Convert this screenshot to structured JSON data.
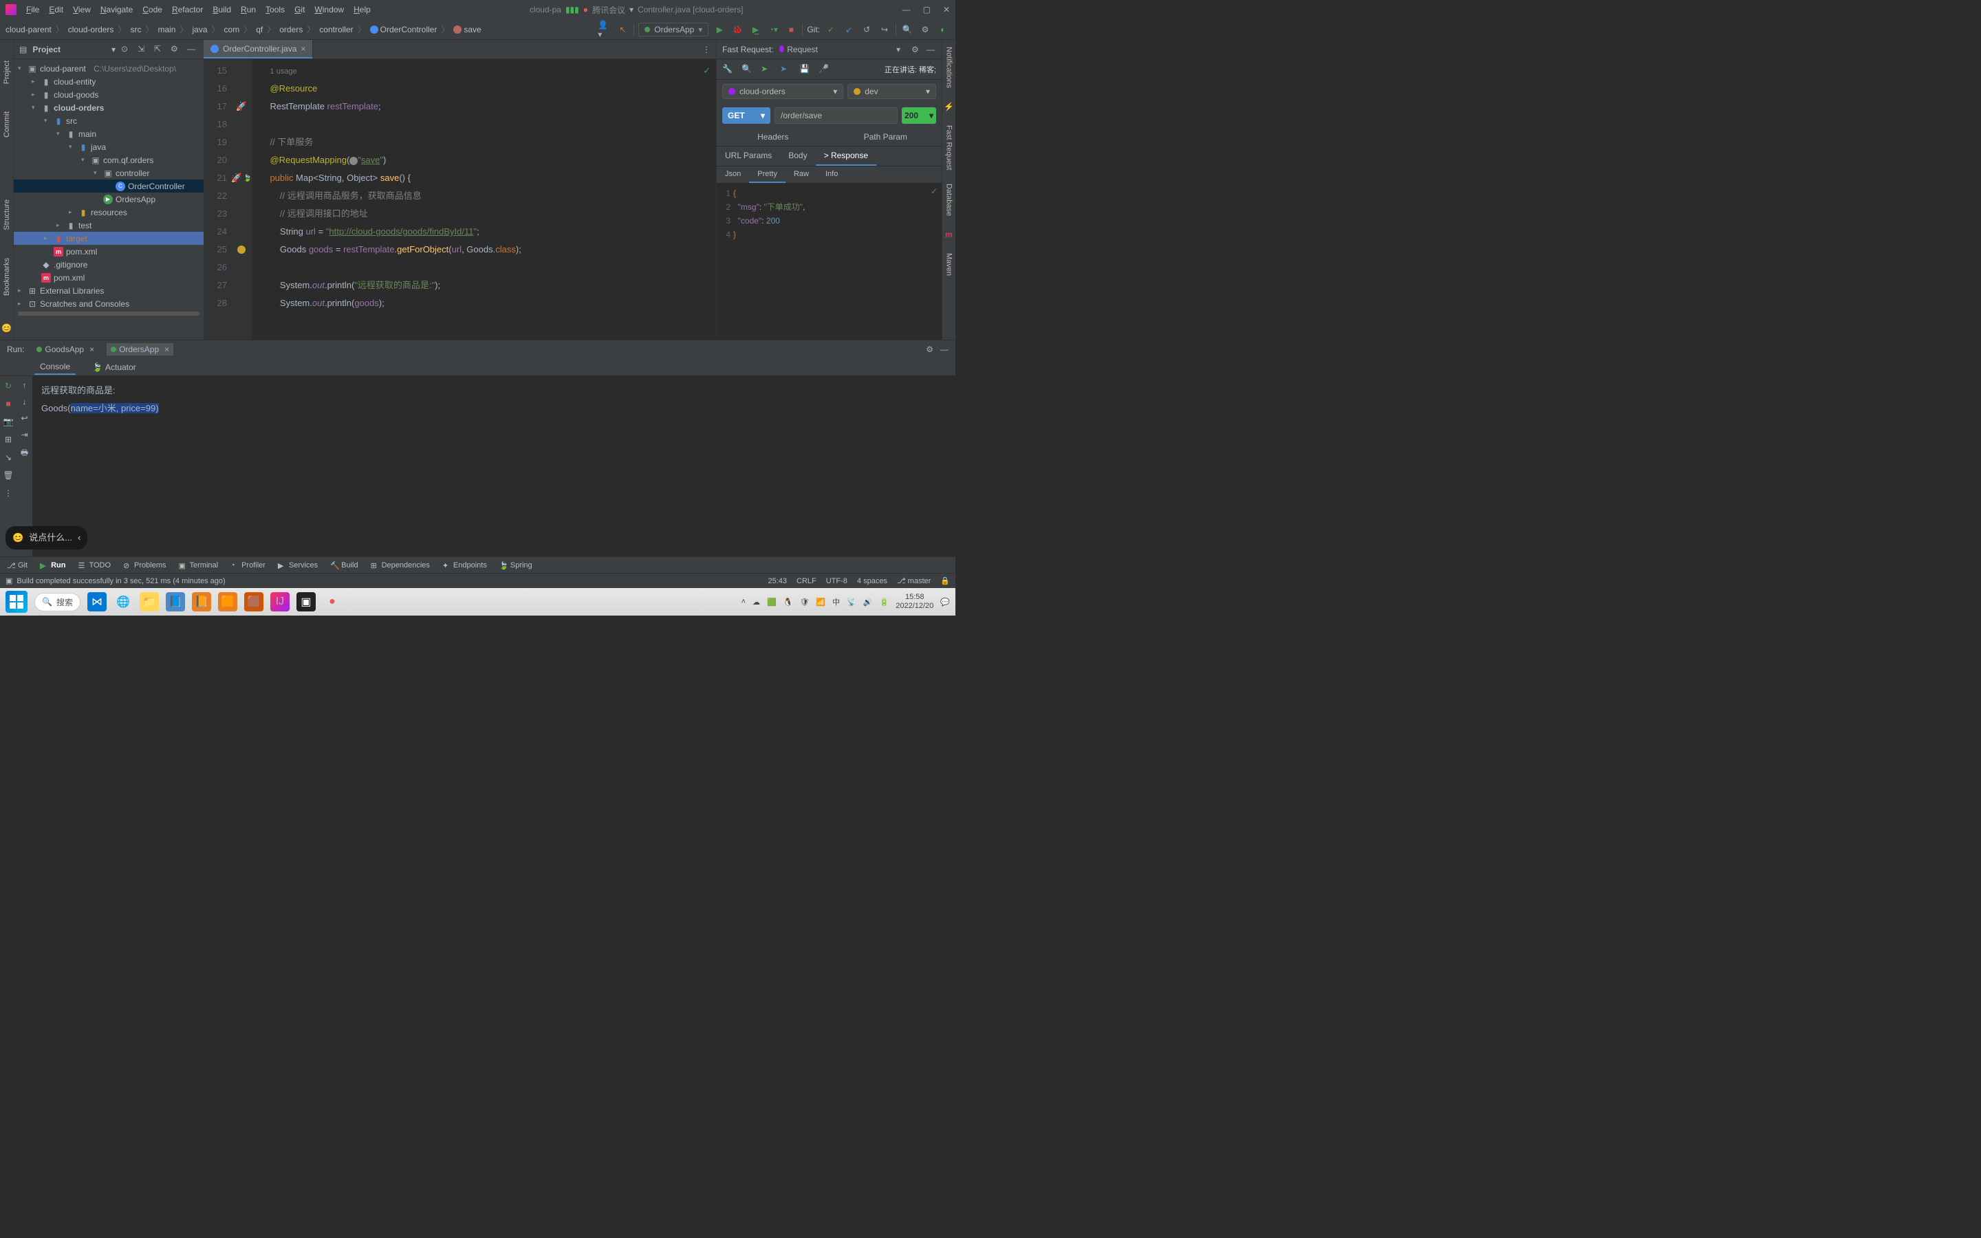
{
  "menubar": {
    "items": [
      "File",
      "Edit",
      "View",
      "Navigate",
      "Code",
      "Refactor",
      "Build",
      "Run",
      "Tools",
      "Git",
      "Window",
      "Help"
    ],
    "center_left": "cloud-pa",
    "meeting_app": "腾讯会议",
    "center_right": "Controller.java [cloud-orders]"
  },
  "breadcrumb": {
    "crumbs": [
      "cloud-parent",
      "cloud-orders",
      "src",
      "main",
      "java",
      "com",
      "qf",
      "orders",
      "controller"
    ],
    "class": "OrderController",
    "method": "save",
    "run_config": "OrdersApp",
    "git_label": "Git:"
  },
  "project": {
    "title": "Project",
    "root": "cloud-parent",
    "root_path": "C:\\Users\\zed\\Desktop\\",
    "nodes": {
      "cloud_entity": "cloud-entity",
      "cloud_goods": "cloud-goods",
      "cloud_orders": "cloud-orders",
      "src": "src",
      "main": "main",
      "java": "java",
      "pkg": "com.qf.orders",
      "controller": "controller",
      "order_controller": "OrderController",
      "orders_app": "OrdersApp",
      "resources": "resources",
      "test": "test",
      "target": "target",
      "pom1": "pom.xml",
      "gitignore": ".gitignore",
      "pom2": "pom.xml",
      "ext_libs": "External Libraries",
      "scratches": "Scratches and Consoles"
    }
  },
  "editor": {
    "tab": "OrderController.java",
    "lines": {
      "usage": "1 usage",
      "l16": "@Resource",
      "l17a": "RestTemplate ",
      "l17b": "restTemplate",
      "l17c": ";",
      "l19": "// 下单服务",
      "l20a": "@RequestMapping",
      "l20b": "(",
      "l20c": "\"",
      "l20d": "save",
      "l20e": "\"",
      "l20f": ")",
      "l21a": "public",
      "l21b": " Map<String, Object> ",
      "l21c": "save",
      "l21d": "() {",
      "l22": "// 远程调用商品服务，获取商品信息",
      "l23": "// 远程调用接口的地址",
      "l24a": "String ",
      "l24b": "url",
      "l24c": " = ",
      "l24d": "\"",
      "l24e": "http://cloud-goods/goods/findById/11",
      "l24f": "\"",
      "l24g": ";",
      "l25a": "Goods ",
      "l25b": "goods",
      "l25c": " = ",
      "l25d": "restTemplate",
      "l25e": ".",
      "l25f": "getForObject",
      "l25g": "(",
      "l25h": "url",
      "l25i": ", Goods.",
      "l25j": "class",
      "l25k": ");",
      "l27a": "System.",
      "l27b": "out",
      "l27c": ".println(",
      "l27d": "\"远程获取的商品是:\"",
      "l27e": ");",
      "l28a": "System.",
      "l28b": "out",
      "l28c": ".println(",
      "l28d": "goods",
      "l28e": ");"
    },
    "gutter_start": 15,
    "gutter_end": 28
  },
  "fast_request": {
    "title": "Fast Request:",
    "request": "Request",
    "talking": "正在讲话: 稀客;",
    "module": "cloud-orders",
    "env": "dev",
    "method": "GET",
    "url": "/order/save",
    "status": "200",
    "tabs1": [
      "Headers",
      "Path Param"
    ],
    "tabs2": [
      "URL Params",
      "Body",
      "> Response"
    ],
    "tabs3": [
      "Json",
      "Pretty",
      "Raw",
      "Info"
    ],
    "response_lines": [
      "{",
      "\"msg\": \"下单成功\",",
      "\"code\": 200",
      "}"
    ],
    "json_msg_key": "\"msg\"",
    "json_msg_val": "\"下单成功\"",
    "json_code_key": "\"code\"",
    "json_code_val": "200"
  },
  "run": {
    "title": "Run:",
    "tabs": [
      "GoodsApp",
      "OrdersApp"
    ],
    "subtabs": [
      "Console",
      "Actuator"
    ],
    "console_line1": "远程获取的商品是:",
    "console_line2a": "Goods(",
    "console_line2b": "name=小米, price=99)",
    "chat_placeholder": "说点什么..."
  },
  "bottom_tools": {
    "items": [
      "Git",
      "Run",
      "TODO",
      "Problems",
      "Terminal",
      "Profiler",
      "Services",
      "Build",
      "Dependencies",
      "Endpoints",
      "Spring"
    ]
  },
  "statusbar": {
    "message": "Build completed successfully in 3 sec, 521 ms (4 minutes ago)",
    "pos": "25:43",
    "eol": "CRLF",
    "encoding": "UTF-8",
    "indent": "4 spaces",
    "branch": "master"
  },
  "left_tabs": [
    "Project",
    "Commit",
    "Structure",
    "Bookmarks"
  ],
  "right_tabs": [
    "Notifications",
    "Fast Request",
    "Database",
    "Maven"
  ],
  "taskbar": {
    "search": "搜索",
    "time": "15:58",
    "date": "2022/12/20"
  }
}
